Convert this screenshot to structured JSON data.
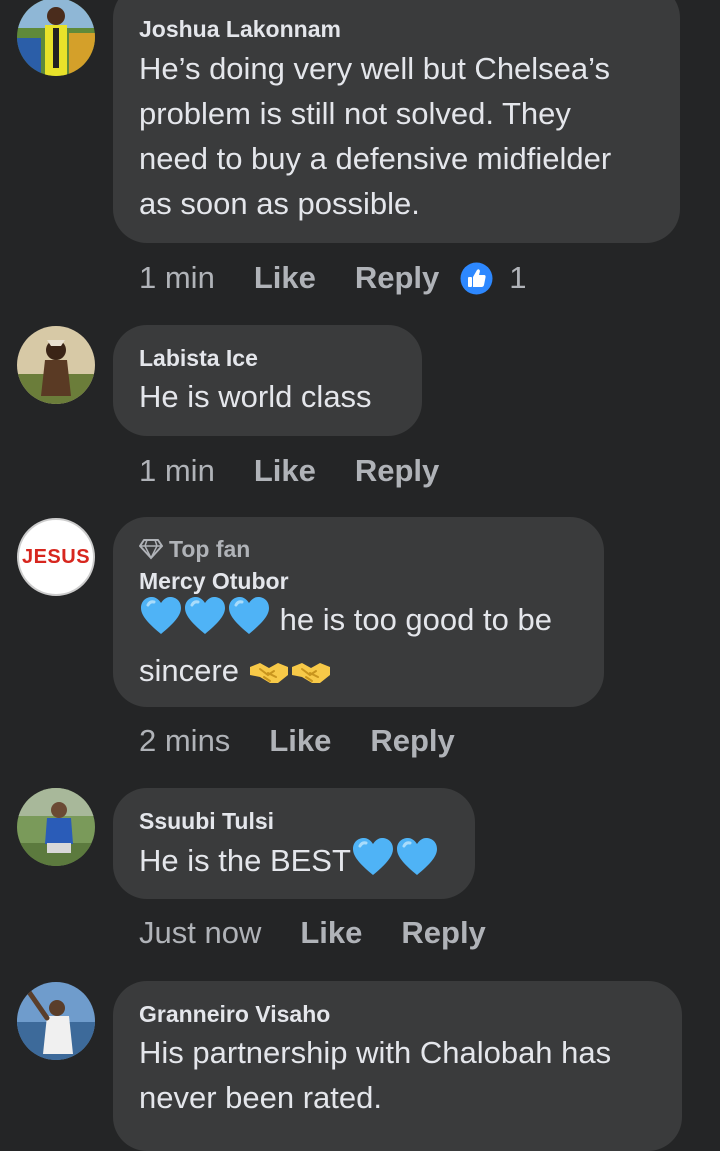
{
  "comments": [
    {
      "author": "Joshua Lakonnam",
      "text_lines": [
        "He’s doing very well but Chelsea’s",
        "problem is still not solved. They",
        "need to buy a defensive midfielder",
        "as soon as possible."
      ],
      "time": "1 min",
      "like_label": "Like",
      "reply_label": "Reply",
      "reaction_count": "1"
    },
    {
      "author": "Labista Ice",
      "text": "He is world class",
      "time": "1 min",
      "like_label": "Like",
      "reply_label": "Reply"
    },
    {
      "avatar_text": "JESUS",
      "badge": "Top fan",
      "author": "Mercy Otubor",
      "text_line1": "he is too good to be",
      "text_line2": "sincere",
      "time": "2 mins",
      "like_label": "Like",
      "reply_label": "Reply"
    },
    {
      "author": "Ssuubi Tulsi",
      "text": "He is the BEST",
      "time": "Just now",
      "like_label": "Like",
      "reply_label": "Reply"
    },
    {
      "author": "Granneiro Visaho",
      "text_lines": [
        "His partnership with Chalobah has",
        "never been rated."
      ]
    }
  ],
  "colors": {
    "background": "#242526",
    "bubble": "#3a3b3c",
    "primary_text": "#e4e6eb",
    "secondary_text": "#b0b3b8",
    "like_blue": "#2d88ff",
    "heart_blue": "#4fb3f6"
  },
  "icons": {
    "like_reaction": "thumbs-up-icon",
    "top_fan": "diamond-icon",
    "heart": "blue-heart-emoji",
    "handshake": "handshake-emoji"
  }
}
